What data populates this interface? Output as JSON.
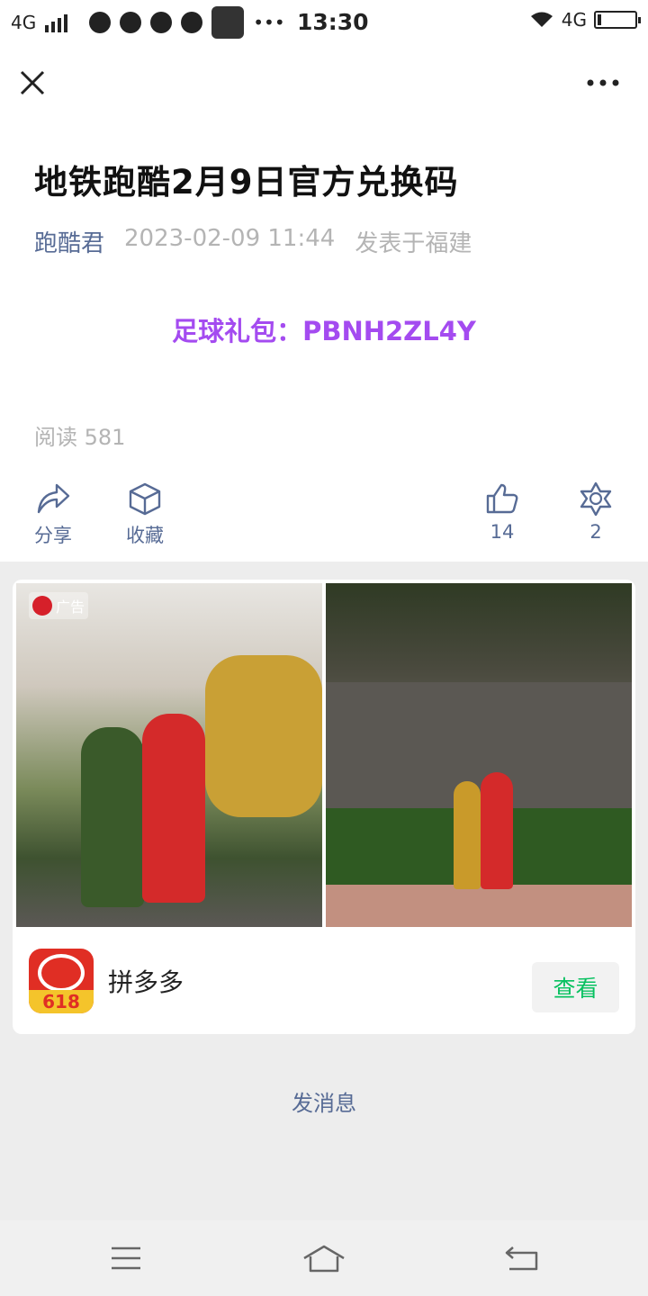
{
  "status_bar": {
    "network_left": "4G",
    "time": "13:30",
    "network_right": "4G",
    "battery_level": 0.1
  },
  "article": {
    "title": "地铁跑酷2月9日官方兑换码",
    "author": "跑酷君",
    "date": "2023-02-09 11:44",
    "location": "发表于福建",
    "code_line": "足球礼包：PBNH2ZL4Y",
    "read_count": "阅读 581"
  },
  "actions": {
    "share_label": "分享",
    "collect_label": "收藏",
    "like_count": "14",
    "wow_count": "2"
  },
  "ad": {
    "badge_label": "广告",
    "app_name": "拼多多",
    "app_logo_text": "618",
    "view_button_label": "查看"
  },
  "footer": {
    "send_message_label": "发消息"
  },
  "colors": {
    "link_blue": "#576b95",
    "code_purple": "#a44bf0",
    "button_green": "#07c160",
    "gray_bg": "#ededed"
  }
}
